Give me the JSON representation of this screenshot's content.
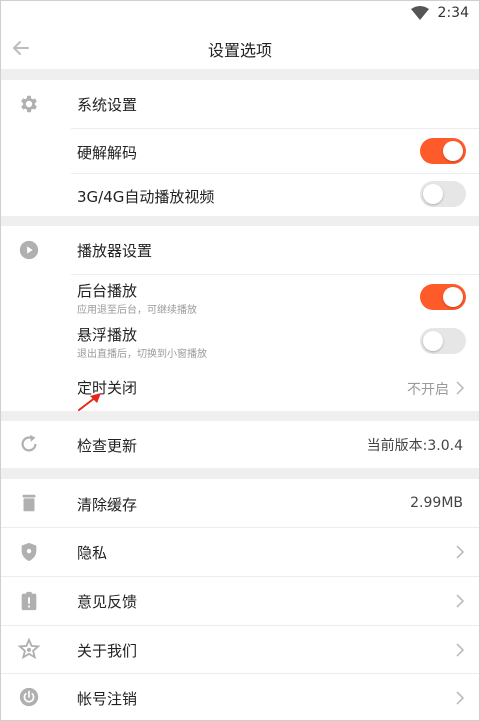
{
  "status_bar": {
    "time": "2:34"
  },
  "header": {
    "title": "设置选项"
  },
  "system_section": {
    "title": "系统设置",
    "hardware_decode": {
      "label": "硬解解码",
      "enabled": true
    },
    "auto_play": {
      "label": "3G/4G自动播放视频",
      "enabled": false
    }
  },
  "player_section": {
    "title": "播放器设置",
    "background_play": {
      "label": "后台播放",
      "desc": "应用退至后台，可继续播放",
      "enabled": true
    },
    "float_play": {
      "label": "悬浮播放",
      "desc": "退出直播后，切换到小窗播放",
      "enabled": false
    },
    "timer_close": {
      "label": "定时关闭",
      "value": "不开启"
    }
  },
  "update": {
    "label": "检查更新",
    "value": "当前版本:3.0.4"
  },
  "list": {
    "clear_cache": {
      "label": "清除缓存",
      "value": "2.99MB"
    },
    "privacy": {
      "label": "隐私"
    },
    "feedback": {
      "label": "意见反馈"
    },
    "about": {
      "label": "关于我们"
    },
    "account_cancel": {
      "label": "帐号注销"
    }
  },
  "colors": {
    "accent": "#ff5a2a",
    "annotation": "#e8261a",
    "icon": "#b0b0b0",
    "gap": "#efefef"
  }
}
